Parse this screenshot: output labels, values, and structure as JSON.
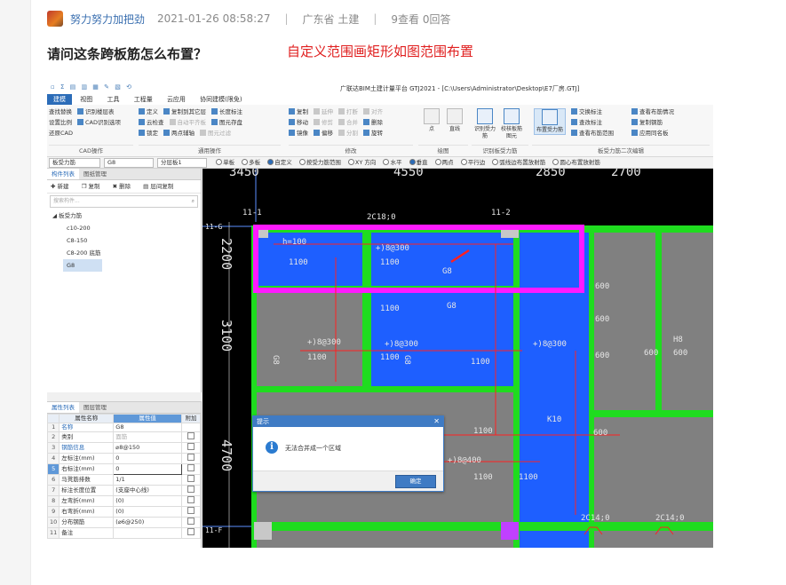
{
  "post": {
    "author": "努力努力加把劲",
    "datetime": "2021-01-26 08:58:27",
    "location": "广东省",
    "category": "土建",
    "views": "9查看",
    "answers": "0回答",
    "title": "请问这条跨板筋怎么布置？",
    "annotation": "自定义范围画矩形如图范围布置"
  },
  "app": {
    "window_title": "广联达BIM土建计量平台 GTJ2021 - [C:\\Users\\Administrator\\Desktop\\E7厂房.GTJ]",
    "menu": [
      "建模",
      "视图",
      "工具",
      "工程量",
      "云应用",
      "协同建模(限免)"
    ],
    "active_menu": "建模",
    "ribbon": {
      "cad": {
        "label": "CAD操作",
        "items": [
          "查找替换",
          "识别楼层表",
          "设置比例",
          "CAD识别选项",
          "还原CAD"
        ]
      },
      "general": {
        "label": "通用操作",
        "items": [
          "定义",
          "复制到其它层",
          "长度标注",
          "云检查",
          "自动平齐板",
          "图元存盘",
          "锁定",
          "两点辅轴",
          "图元过滤"
        ]
      },
      "modify": {
        "label": "修改",
        "items": [
          "复制",
          "延伸",
          "打断",
          "对齐",
          "移动",
          "修剪",
          "合并",
          "删除",
          "镜像",
          "偏移",
          "分割",
          "旋转"
        ]
      },
      "draw": {
        "label": "绘图",
        "items": [
          "点",
          "直线"
        ]
      },
      "identify": {
        "label": "识别板受力筋",
        "items": [
          "识别受力筋",
          "校核板筋图元"
        ]
      },
      "layout": {
        "label": "布置受力筋"
      },
      "secondary": {
        "label": "板受力筋二次编辑",
        "items": [
          "交换标注",
          "查改标注",
          "查看布筋范围",
          "查看布筋情况",
          "复制钢筋",
          "应用同名板"
        ]
      }
    },
    "options_bar": {
      "combo1": "板受力筋",
      "combo2": "G8",
      "combo3": "分层板1",
      "radios": [
        "单板",
        "多板",
        "自定义",
        "按受力筋范围",
        "XY 方向",
        "水平",
        "垂直",
        "两点",
        "平行边",
        "弧线边布置放射筋",
        "圆心布置放射筋"
      ]
    },
    "component_panel": {
      "tabs": [
        "构件列表",
        "图纸管理"
      ],
      "tools": [
        "新建",
        "复制",
        "删除",
        "层间复制"
      ],
      "search_placeholder": "搜索构件...",
      "tree_root": "板受力筋",
      "items": [
        "c10-200",
        "C8-150",
        "C8-200 底筋",
        "G8"
      ],
      "selected": "G8"
    },
    "property_panel": {
      "tabs": [
        "属性列表",
        "图层管理"
      ],
      "headers": [
        "属性名称",
        "属性值",
        "附加"
      ],
      "rows": [
        {
          "num": "1",
          "name": "名称",
          "value": "G8"
        },
        {
          "num": "2",
          "name": "类别",
          "value": "面筋"
        },
        {
          "num": "3",
          "name": "钢筋信息",
          "value": "⌀8@150"
        },
        {
          "num": "4",
          "name": "左标注(mm)",
          "value": "0"
        },
        {
          "num": "5",
          "name": "右标注(mm)",
          "value": "0"
        },
        {
          "num": "6",
          "name": "马凳筋排数",
          "value": "1/1"
        },
        {
          "num": "7",
          "name": "标注长度位置",
          "value": "(支座中心线)"
        },
        {
          "num": "8",
          "name": "左弯折(mm)",
          "value": "(0)"
        },
        {
          "num": "9",
          "name": "右弯折(mm)",
          "value": "(0)"
        },
        {
          "num": "10",
          "name": "分布钢筋",
          "value": "(⌀6@250)"
        },
        {
          "num": "11",
          "name": "备注",
          "value": ""
        }
      ]
    },
    "drawing": {
      "axis_top": [
        "11-1",
        "11-2"
      ],
      "axis_left": [
        "11-G",
        "11-F"
      ],
      "dims_left": [
        "2200",
        "3100",
        "4700"
      ],
      "dims_top": [
        "3450",
        "4550",
        "2850",
        "2700"
      ],
      "rebar_labels": [
        "2C18;0",
        "h=100",
        "+)8@300",
        "+)8@300",
        "1100",
        "1100",
        "1100",
        "1100",
        "G8",
        "G8",
        "+)8@300",
        "1100",
        "G8",
        "+)8@300",
        "G8",
        "1100",
        "1100",
        "+)8@300",
        "600",
        "600",
        "600",
        "600",
        "600",
        "H8",
        "K10",
        "1100",
        "+)8@400",
        "1100",
        "1100",
        "2C14;0",
        "2C14;0",
        "600"
      ],
      "colors": {
        "slab_blue": "#1e5fff",
        "slab_gray": "#808080",
        "beam_green": "#1fdc1f",
        "selection_magenta": "#ff1aff",
        "rebar_red": "#ff2020",
        "text_white": "#e6e6e6"
      }
    },
    "dialog": {
      "title": "提示",
      "message": "无法合并成一个区域",
      "ok": "确定"
    }
  }
}
